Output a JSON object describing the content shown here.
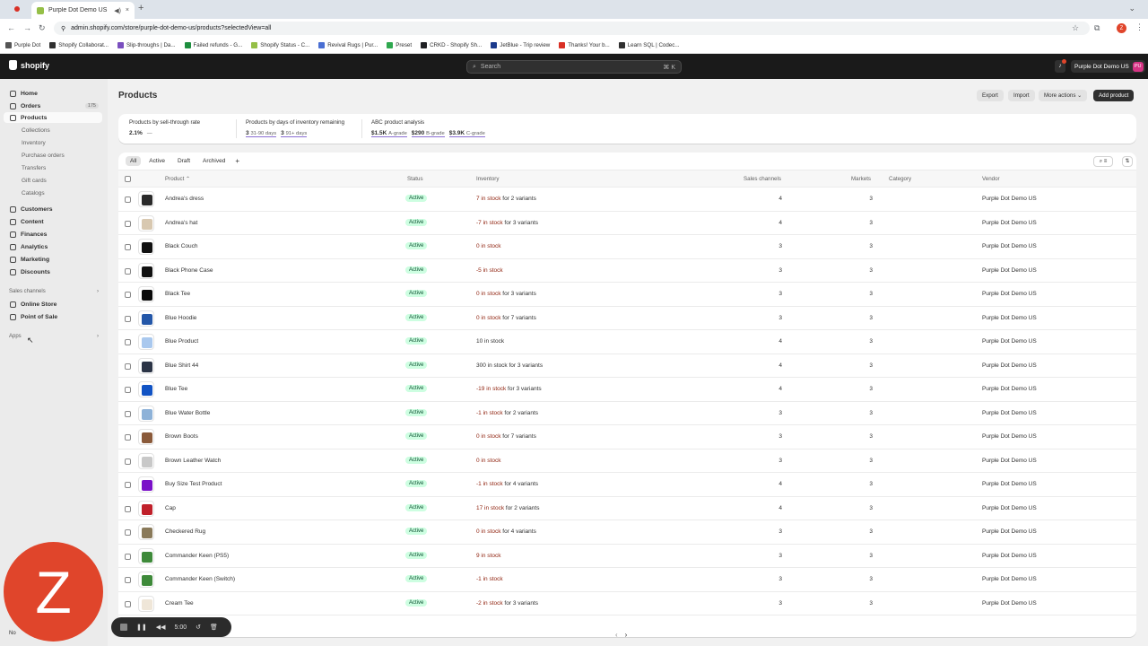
{
  "browser": {
    "tab_title": "Purple Dot Demo US · Pr...",
    "new_tab": "+",
    "tab_close": "×",
    "url": "admin.shopify.com/store/purple-dot-demo-us/products?selectedView=all",
    "profile_initial": "Z",
    "bookmarks": [
      {
        "label": "Purple Dot",
        "color": "#555555"
      },
      {
        "label": "Shopify Collaborat...",
        "color": "#303030"
      },
      {
        "label": "Slip-throughs | Da...",
        "color": "#7a4fbf"
      },
      {
        "label": "Failed refunds - G...",
        "color": "#1e8e3e"
      },
      {
        "label": "Shopify Status - C...",
        "color": "#95bf47"
      },
      {
        "label": "Revival Rugs | Pur...",
        "color": "#4a6fd3"
      },
      {
        "label": "Preset",
        "color": "#2fa84f"
      },
      {
        "label": "CRKD - Shopify Sh...",
        "color": "#202124"
      },
      {
        "label": "JetBlue - Trip review",
        "color": "#1b3a8c"
      },
      {
        "label": "Thanks! Your b...",
        "color": "#d93025"
      },
      {
        "label": "Learn SQL | Codec...",
        "color": "#303030"
      }
    ]
  },
  "topbar": {
    "logo": "shopify",
    "search_placeholder": "Search",
    "search_shortcut": "⌘ K",
    "store_name": "Purple Dot Demo US",
    "store_initials": "PU"
  },
  "sidebar": {
    "items": [
      {
        "label": "Home",
        "icon": "home-icon"
      },
      {
        "label": "Orders",
        "icon": "orders-icon",
        "count": "175"
      },
      {
        "label": "Products",
        "icon": "products-icon",
        "active": true
      }
    ],
    "product_sub": [
      "Collections",
      "Inventory",
      "Purchase orders",
      "Transfers",
      "Gift cards",
      "Catalogs"
    ],
    "items2": [
      {
        "label": "Customers"
      },
      {
        "label": "Content"
      },
      {
        "label": "Finances"
      },
      {
        "label": "Analytics"
      },
      {
        "label": "Marketing"
      },
      {
        "label": "Discounts"
      }
    ],
    "sales_channels_heading": "Sales channels",
    "channels": [
      "Online Store",
      "Point of Sale"
    ],
    "apps_heading": "Apps",
    "chevron": "›"
  },
  "page": {
    "title": "Products",
    "export": "Export",
    "import": "Import",
    "more_actions": "More actions ⌄",
    "add_product": "Add product"
  },
  "analytics": {
    "m1_title": "Products by sell-through rate",
    "m1_value": "2.1%",
    "m1_extra": "—",
    "m2_title": "Products by days of inventory remaining",
    "m2_a": "3",
    "m2_a_label": "31-90 days",
    "m2_b": "3",
    "m2_b_label": "91+ days",
    "m3_title": "ABC product analysis",
    "m3_a": "$1.5K",
    "m3_a_label": "A-grade",
    "m3_b": "$290",
    "m3_b_label": "B-grade",
    "m3_c": "$3.9K",
    "m3_c_label": "C-grade"
  },
  "filters": {
    "tabs": [
      "All",
      "Active",
      "Draft",
      "Archived"
    ],
    "add": "+",
    "search_filter": "⌕ ≡",
    "sort": "⇅"
  },
  "columns": {
    "product": "Product ⌃",
    "status": "Status",
    "inventory": "Inventory",
    "sales_channels": "Sales channels",
    "markets": "Markets",
    "category": "Category",
    "vendor": "Vendor"
  },
  "rows": [
    {
      "name": "Andrea's dress",
      "status": "Active",
      "inv_stock": "7 in stock",
      "inv_suffix": " for 2 variants",
      "inv_neg": true,
      "channels": "4",
      "markets": "3",
      "vendor": "Purple Dot Demo US",
      "thumb": "#2a2a2a"
    },
    {
      "name": "Andrea's hat",
      "status": "Active",
      "inv_stock": "-7 in stock",
      "inv_suffix": " for 3 variants",
      "inv_neg": true,
      "channels": "4",
      "markets": "3",
      "vendor": "Purple Dot Demo US",
      "thumb": "#d8c8b0"
    },
    {
      "name": "Black Couch",
      "status": "Active",
      "inv_stock": "0 in stock",
      "inv_suffix": "",
      "inv_neg": true,
      "channels": "3",
      "markets": "3",
      "vendor": "Purple Dot Demo US",
      "thumb": "#111111"
    },
    {
      "name": "Black Phone Case",
      "status": "Active",
      "inv_stock": "-5 in stock",
      "inv_suffix": "",
      "inv_neg": true,
      "channels": "3",
      "markets": "3",
      "vendor": "Purple Dot Demo US",
      "thumb": "#111111"
    },
    {
      "name": "Black Tee",
      "status": "Active",
      "inv_stock": "0 in stock",
      "inv_suffix": " for 3 variants",
      "inv_neg": true,
      "channels": "3",
      "markets": "3",
      "vendor": "Purple Dot Demo US",
      "thumb": "#0a0a0a"
    },
    {
      "name": "Blue Hoodie",
      "status": "Active",
      "inv_stock": "0 in stock",
      "inv_suffix": " for 7 variants",
      "inv_neg": true,
      "channels": "3",
      "markets": "3",
      "vendor": "Purple Dot Demo US",
      "thumb": "#2457a8"
    },
    {
      "name": "Blue Product",
      "status": "Active",
      "inv_stock": "10 in stock",
      "inv_suffix": "",
      "inv_neg": false,
      "channels": "4",
      "markets": "3",
      "vendor": "Purple Dot Demo US",
      "thumb": "#a9c8ee"
    },
    {
      "name": "Blue Shirt 44",
      "status": "Active",
      "inv_stock": "300 in stock",
      "inv_suffix": " for 3 variants",
      "inv_neg": false,
      "channels": "4",
      "markets": "3",
      "vendor": "Purple Dot Demo US",
      "thumb": "#2b3446"
    },
    {
      "name": "Blue Tee",
      "status": "Active",
      "inv_stock": "-19 in stock",
      "inv_suffix": " for 3 variants",
      "inv_neg": true,
      "channels": "4",
      "markets": "3",
      "vendor": "Purple Dot Demo US",
      "thumb": "#1153c4"
    },
    {
      "name": "Blue Water Bottle",
      "status": "Active",
      "inv_stock": "-1 in stock",
      "inv_suffix": " for 2 variants",
      "inv_neg": true,
      "channels": "3",
      "markets": "3",
      "vendor": "Purple Dot Demo US",
      "thumb": "#8eb2d8"
    },
    {
      "name": "Brown Boots",
      "status": "Active",
      "inv_stock": "0 in stock",
      "inv_suffix": " for 7 variants",
      "inv_neg": true,
      "channels": "3",
      "markets": "3",
      "vendor": "Purple Dot Demo US",
      "thumb": "#8a5a3a"
    },
    {
      "name": "Brown Leather Watch",
      "status": "Active",
      "inv_stock": "0 in stock",
      "inv_suffix": "",
      "inv_neg": true,
      "channels": "3",
      "markets": "3",
      "vendor": "Purple Dot Demo US",
      "thumb": "#c8c8c8"
    },
    {
      "name": "Buy Size Test Product",
      "status": "Active",
      "inv_stock": "-1 in stock",
      "inv_suffix": " for 4 variants",
      "inv_neg": true,
      "channels": "4",
      "markets": "3",
      "vendor": "Purple Dot Demo US",
      "thumb": "#7a10c8"
    },
    {
      "name": "Cap",
      "status": "Active",
      "inv_stock": "17 in stock",
      "inv_suffix": " for 2 variants",
      "inv_neg": true,
      "channels": "4",
      "markets": "3",
      "vendor": "Purple Dot Demo US",
      "thumb": "#c0202a"
    },
    {
      "name": "Checkered Rug",
      "status": "Active",
      "inv_stock": "0 in stock",
      "inv_suffix": " for 4 variants",
      "inv_neg": true,
      "channels": "3",
      "markets": "3",
      "vendor": "Purple Dot Demo US",
      "thumb": "#8a7a5a"
    },
    {
      "name": "Commander Keen (PS5)",
      "status": "Active",
      "inv_stock": "9 in stock",
      "inv_suffix": "",
      "inv_neg": true,
      "channels": "3",
      "markets": "3",
      "vendor": "Purple Dot Demo US",
      "thumb": "#3e8a3a"
    },
    {
      "name": "Commander Keen (Switch)",
      "status": "Active",
      "inv_stock": "-1 in stock",
      "inv_suffix": "",
      "inv_neg": true,
      "channels": "3",
      "markets": "3",
      "vendor": "Purple Dot Demo US",
      "thumb": "#3e8a3a"
    },
    {
      "name": "Cream Tee",
      "status": "Active",
      "inv_stock": "-2 in stock",
      "inv_suffix": " for 3 variants",
      "inv_neg": true,
      "channels": "3",
      "markets": "3",
      "vendor": "Purple Dot Demo US",
      "thumb": "#efe6d8"
    }
  ],
  "recorder": {
    "avatar_letter": "Z",
    "time": "5:00",
    "notif_label": "No"
  },
  "pager": {
    "prev": "‹",
    "next": "›"
  }
}
